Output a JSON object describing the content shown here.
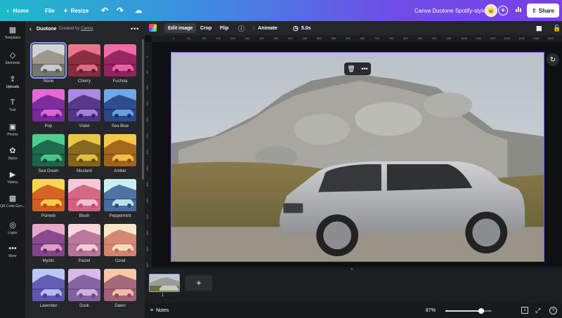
{
  "topbar": {
    "home": "Home",
    "file": "File",
    "resize": "Resize",
    "undo_icon": "↶",
    "redo_icon": "↷",
    "cloud_icon": "☁",
    "title": "Canva Duotone Spotify-style",
    "avatar_initial": "🐱",
    "add_icon": "+",
    "stats_icon": "📊",
    "share": "Share"
  },
  "rail": [
    {
      "label": "Templates",
      "icon": "▦"
    },
    {
      "label": "Elements",
      "icon": "◇"
    },
    {
      "label": "Uploads",
      "icon": "⇪"
    },
    {
      "label": "Text",
      "icon": "T"
    },
    {
      "label": "Photos",
      "icon": "▣"
    },
    {
      "label": "Styles",
      "icon": "✿"
    },
    {
      "label": "Videos",
      "icon": "▶"
    },
    {
      "label": "QR Code Gen...",
      "icon": "▩"
    },
    {
      "label": "Logos",
      "icon": "◎"
    },
    {
      "label": "More",
      "icon": "•••"
    }
  ],
  "panel": {
    "back_icon": "‹",
    "title": "Duotone",
    "created_by": "Created by",
    "author": "Canva",
    "more_icon": "•••",
    "filters": [
      {
        "label": "None",
        "dark": "#000000",
        "light": "#ffffff",
        "none": true
      },
      {
        "label": "Cherry",
        "dark": "#6b1a2a",
        "light": "#e8758a"
      },
      {
        "label": "Fuchsia",
        "dark": "#7a1248",
        "light": "#f06aa8"
      },
      {
        "label": "Pop",
        "dark": "#5a1a8a",
        "light": "#e56ad6"
      },
      {
        "label": "Violet",
        "dark": "#3b1e6e",
        "light": "#a98ae0"
      },
      {
        "label": "Sea Blue",
        "dark": "#1a2f6e",
        "light": "#6fa8e8"
      },
      {
        "label": "Sea Green",
        "dark": "#0f4a3a",
        "light": "#4fcf8e"
      },
      {
        "label": "Mustard",
        "dark": "#6a4a10",
        "light": "#e8c84a"
      },
      {
        "label": "Amber",
        "dark": "#8a4a10",
        "light": "#f8c84a"
      },
      {
        "label": "Pomelo",
        "dark": "#c8401a",
        "light": "#f8d84a"
      },
      {
        "label": "Blush",
        "dark": "#c84a6a",
        "light": "#f8c8d8"
      },
      {
        "label": "Peppermint",
        "dark": "#2a4a8a",
        "light": "#c8f0f0"
      },
      {
        "label": "Mystic",
        "dark": "#6a2a7a",
        "light": "#e8a8c8"
      },
      {
        "label": "Pastel",
        "dark": "#a85a8a",
        "light": "#f8d8d8"
      },
      {
        "label": "Coral",
        "dark": "#c86a5a",
        "light": "#f8e8c8"
      },
      {
        "label": "Lavender",
        "dark": "#4a3a9a",
        "light": "#b8c8f8"
      },
      {
        "label": "Dusk",
        "dark": "#6a4a8a",
        "light": "#d8b8e8"
      },
      {
        "label": "Dawn",
        "dark": "#8a4a6a",
        "light": "#f8c8a8"
      }
    ]
  },
  "context": {
    "edit_image": "Edit image",
    "crop": "Crop",
    "flip": "Flip",
    "info_icon": "ⓘ",
    "animate": "Animate",
    "animate_icon": "◌",
    "duration": "5.0s",
    "timer_icon": "◷",
    "checker_icon": "▦",
    "lock_icon": "🔓"
  },
  "ruler_h": [
    "0",
    "50",
    "100",
    "150",
    "200",
    "250",
    "300",
    "350",
    "400",
    "450",
    "500",
    "550",
    "600",
    "650",
    "700",
    "750",
    "800",
    "850",
    "900",
    "950",
    "1000",
    "1050",
    "1100",
    "1150",
    "1200",
    "1250",
    "1300"
  ],
  "ruler_v": [
    "0",
    "50",
    "100",
    "150",
    "200",
    "250",
    "300",
    "350",
    "400",
    "450",
    "500",
    "550",
    "600",
    "650"
  ],
  "float_toolbar": {
    "trash_icon": "🗑",
    "more_icon": "•••"
  },
  "refresh_icon": "↻",
  "pages": {
    "page_number": "1",
    "add_icon": "+",
    "collapse_icon": "⌄"
  },
  "bottombar": {
    "notes_icon": "≡",
    "notes": "Notes",
    "zoom": "87%",
    "zoom_fraction": 0.78,
    "page_count": "1",
    "fullscreen_icon": "⤢",
    "help_icon": "?"
  }
}
